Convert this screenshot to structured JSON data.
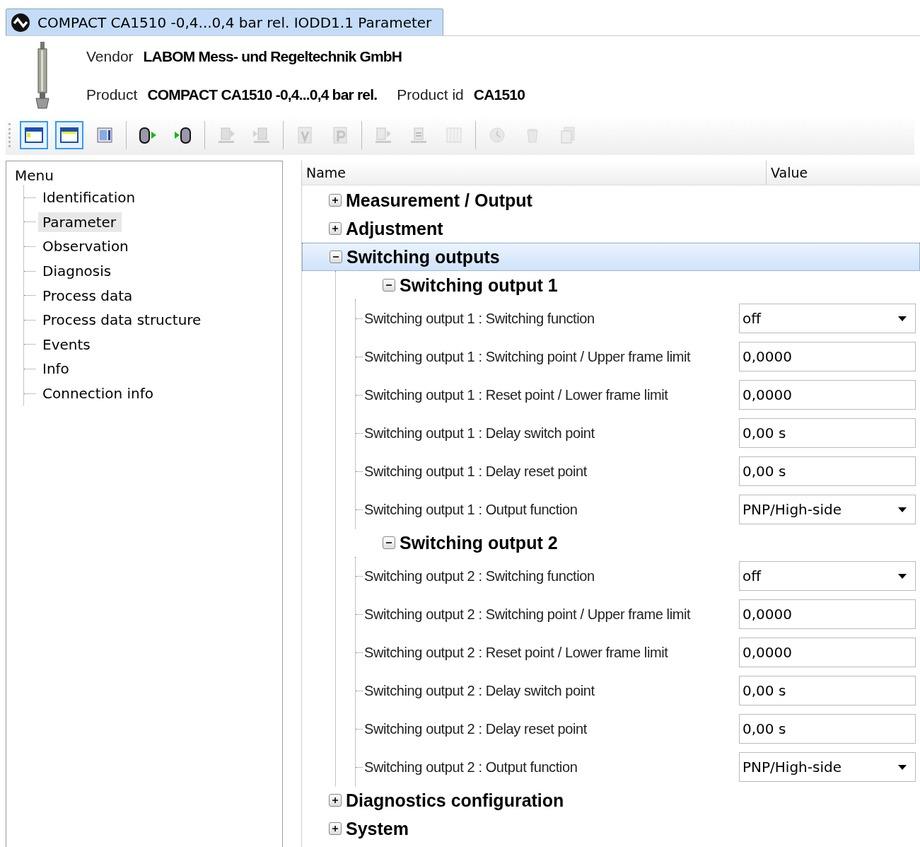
{
  "tab": {
    "title": "COMPACT CA1510 -0,4...0,4 bar rel. IODD1.1 Parameter",
    "selected": true
  },
  "header": {
    "vendor_label": "Vendor",
    "vendor": "LABOM Mess- und Regeltechnik GmbH",
    "product_label": "Product",
    "product": "COMPACT CA1510 -0,4...0,4 bar rel.",
    "product_id_label": "Product id",
    "product_id": "CA1510"
  },
  "toolbar_groups": [
    [
      {
        "selected": true,
        "disabled": false
      },
      {
        "selected": true,
        "disabled": false
      },
      {
        "selected": false,
        "disabled": false
      }
    ],
    [
      {
        "selected": false,
        "disabled": false
      },
      {
        "selected": false,
        "disabled": false
      }
    ],
    [
      {
        "selected": false,
        "disabled": true
      },
      {
        "selected": false,
        "disabled": true
      }
    ],
    [
      {
        "selected": false,
        "disabled": true
      },
      {
        "selected": false,
        "disabled": true
      }
    ],
    [
      {
        "selected": false,
        "disabled": true
      },
      {
        "selected": false,
        "disabled": true
      },
      {
        "selected": false,
        "disabled": true
      }
    ],
    [
      {
        "selected": false,
        "disabled": true
      },
      {
        "selected": false,
        "disabled": true
      },
      {
        "selected": false,
        "disabled": true
      }
    ]
  ],
  "menu": {
    "title": "Menu",
    "items": [
      {
        "label": "Identification",
        "selected": false
      },
      {
        "label": "Parameter",
        "selected": true
      },
      {
        "label": "Observation",
        "selected": false
      },
      {
        "label": "Diagnosis",
        "selected": false
      },
      {
        "label": "Process data",
        "selected": false
      },
      {
        "label": "Process data structure",
        "selected": false
      },
      {
        "label": "Events",
        "selected": false
      },
      {
        "label": "Info",
        "selected": false
      },
      {
        "label": "Connection info",
        "selected": false
      }
    ]
  },
  "table": {
    "columns": [
      "Name",
      "Value"
    ],
    "rows": [
      {
        "kind": "group",
        "label": "Measurement / Output",
        "expanded": false,
        "selected": false
      },
      {
        "kind": "group",
        "label": "Adjustment",
        "expanded": false,
        "selected": false
      },
      {
        "kind": "group",
        "label": "Switching outputs",
        "expanded": true,
        "selected": true,
        "children": [
          {
            "kind": "group",
            "label": "Switching output 1",
            "expanded": true,
            "selected": false,
            "children": [
              {
                "kind": "dropdown",
                "label": "Switching output 1 : Switching function",
                "value": "off"
              },
              {
                "kind": "input",
                "label": "Switching output 1 : Switching point / Upper frame limit",
                "value": "0,0000"
              },
              {
                "kind": "input",
                "label": "Switching output 1 : Reset point / Lower frame limit",
                "value": "0,0000"
              },
              {
                "kind": "input",
                "label": "Switching output 1 : Delay switch point",
                "value": "0,00 s"
              },
              {
                "kind": "input",
                "label": "Switching output 1 : Delay reset point",
                "value": "0,00 s"
              },
              {
                "kind": "dropdown",
                "label": "Switching output 1 : Output function",
                "value": "PNP/High-side"
              }
            ]
          },
          {
            "kind": "group",
            "label": "Switching output 2",
            "expanded": true,
            "selected": false,
            "children": [
              {
                "kind": "dropdown",
                "label": "Switching output 2 : Switching function",
                "value": "off"
              },
              {
                "kind": "input",
                "label": "Switching output 2 : Switching point / Upper frame limit",
                "value": "0,0000"
              },
              {
                "kind": "input",
                "label": "Switching output 2 : Reset point / Lower frame limit",
                "value": "0,0000"
              },
              {
                "kind": "input",
                "label": "Switching output 2 : Delay switch point",
                "value": "0,00 s"
              },
              {
                "kind": "input",
                "label": "Switching output 2 : Delay reset point",
                "value": "0,00 s"
              },
              {
                "kind": "dropdown",
                "label": "Switching output 2 : Output function",
                "value": "PNP/High-side"
              }
            ]
          }
        ]
      },
      {
        "kind": "group",
        "label": "Diagnostics configuration",
        "expanded": false,
        "selected": false
      },
      {
        "kind": "group",
        "label": "System",
        "expanded": false,
        "selected": false
      }
    ]
  }
}
